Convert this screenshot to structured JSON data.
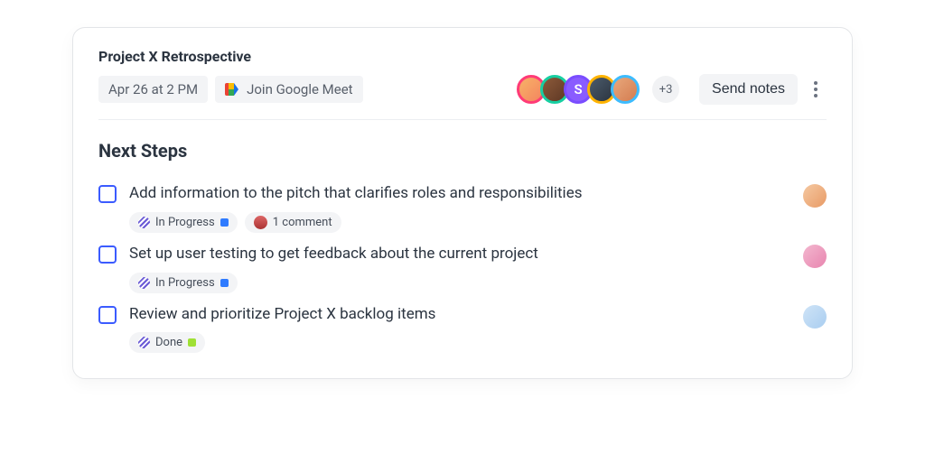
{
  "title": "Project X Retrospective",
  "datetime": "Apr 26 at 2 PM",
  "joinLabel": "Join Google Meet",
  "avatars": [
    {
      "ring": "#ff3b77",
      "bg": "linear-gradient(135deg,#f7b267,#f4845f)",
      "initial": ""
    },
    {
      "ring": "#17cfa2",
      "bg": "linear-gradient(135deg,#8c5a3a,#5e3824)",
      "initial": ""
    },
    {
      "ring": "#7a4dff",
      "bg": "#8a5cff",
      "initial": "S"
    },
    {
      "ring": "#ffb300",
      "bg": "linear-gradient(135deg,#4b5b6b,#2b3440)",
      "initial": ""
    },
    {
      "ring": "#3dbcff",
      "bg": "linear-gradient(135deg,#e8a87c,#d47c50)",
      "initial": ""
    }
  ],
  "moreCount": "+3",
  "sendNotes": "Send notes",
  "sectionTitle": "Next Steps",
  "tasks": [
    {
      "text": "Add information to the pitch that clarifies roles and responsibilities",
      "status": "In Progress",
      "statusColor": "#2f7bff",
      "comment": "1 comment",
      "assigneeBg": "linear-gradient(135deg,#f5c9a2,#e89a65)"
    },
    {
      "text": "Set up user testing to get feedback about the current project",
      "status": "In Progress",
      "statusColor": "#2f7bff",
      "comment": null,
      "assigneeBg": "linear-gradient(135deg,#f3b7cf,#e885af)"
    },
    {
      "text": "Review and prioritize Project X backlog items",
      "status": "Done",
      "statusColor": "#9fe035",
      "comment": null,
      "assigneeBg": "linear-gradient(135deg,#cfe4f7,#a9cdf0)"
    }
  ]
}
